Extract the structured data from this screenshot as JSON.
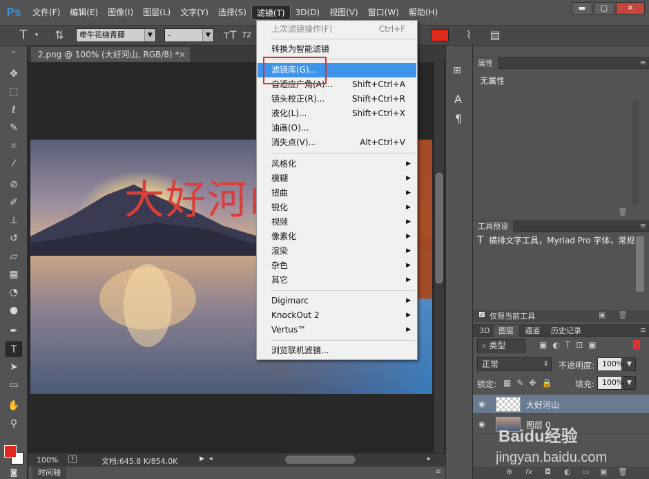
{
  "app": {
    "logo": "Ps"
  },
  "menubar": {
    "items": [
      "文件(F)",
      "编辑(E)",
      "图像(I)",
      "图层(L)",
      "文字(Y)",
      "选择(S)",
      "滤镜(T)",
      "3D(D)",
      "视图(V)",
      "窗口(W)",
      "帮助(H)"
    ],
    "active_index": 6
  },
  "window_controls": {
    "minimize": "▬",
    "maximize": "▢",
    "close": "✕"
  },
  "options_bar": {
    "font_family": "牵牛花绕青藤",
    "font_style": "-",
    "font_size": "72",
    "color_swatch": "#e0281e"
  },
  "document": {
    "tab_label": "2.png @ 100% (大好河山, RGB/8) *",
    "canvas_text": "大好河山",
    "zoom": "100%",
    "doc_info": "文档:645.8 K/854.0K"
  },
  "timeline": {
    "label": "时间轴"
  },
  "filter_menu": {
    "items": [
      {
        "label": "上次滤镜操作(F)",
        "shortcut": "Ctrl+F",
        "disabled": true
      },
      {
        "label": "转换为智能滤镜",
        "shortcut": ""
      },
      {
        "label": "滤镜库(G)...",
        "shortcut": "",
        "highlighted": true
      },
      {
        "label": "自适应广角(A)...",
        "shortcut": "Shift+Ctrl+A"
      },
      {
        "label": "镜头校正(R)...",
        "shortcut": "Shift+Ctrl+R"
      },
      {
        "label": "液化(L)...",
        "shortcut": "Shift+Ctrl+X"
      },
      {
        "label": "油画(O)...",
        "shortcut": ""
      },
      {
        "label": "消失点(V)...",
        "shortcut": "Alt+Ctrl+V"
      },
      {
        "label": "风格化",
        "submenu": true
      },
      {
        "label": "模糊",
        "submenu": true
      },
      {
        "label": "扭曲",
        "submenu": true
      },
      {
        "label": "锐化",
        "submenu": true
      },
      {
        "label": "视频",
        "submenu": true
      },
      {
        "label": "像素化",
        "submenu": true
      },
      {
        "label": "渲染",
        "submenu": true
      },
      {
        "label": "杂色",
        "submenu": true
      },
      {
        "label": "其它",
        "submenu": true
      },
      {
        "label": "Digimarc",
        "submenu": true
      },
      {
        "label": "KnockOut 2",
        "submenu": true
      },
      {
        "label": "Vertus™",
        "submenu": true
      },
      {
        "label": "浏览联机滤镜..."
      }
    ]
  },
  "properties_panel": {
    "title": "属性",
    "content": "无属性"
  },
  "tool_presets_panel": {
    "title": "工具预设",
    "preset": "横排文字工具，Myriad Pro 字体，常规",
    "only_current_label": "仅限当前工具"
  },
  "layers_panel": {
    "tabs": [
      "3D",
      "图层",
      "通道",
      "历史记录"
    ],
    "active_tab": 1,
    "filter_kind": "类型",
    "blend_mode": "正常",
    "opacity_label": "不透明度:",
    "opacity_value": "100%",
    "lock_label": "锁定:",
    "fill_label": "填充:",
    "fill_value": "100%",
    "layers": [
      {
        "name": "大好河山",
        "selected": true
      },
      {
        "name": "图层 0",
        "selected": false
      }
    ]
  },
  "watermark": {
    "brand": "Baidu经验",
    "url": "jingyan.baidu.com"
  },
  "icons": [
    "move-icon",
    "marquee-icon",
    "lasso-icon",
    "quick-select-icon",
    "crop-icon",
    "eyedropper-icon",
    "healing-icon",
    "brush-icon",
    "stamp-icon",
    "history-brush-icon",
    "eraser-icon",
    "gradient-icon",
    "blur-icon",
    "dodge-icon",
    "pen-icon",
    "type-icon",
    "path-select-icon",
    "rectangle-icon",
    "hand-icon",
    "zoom-icon"
  ]
}
